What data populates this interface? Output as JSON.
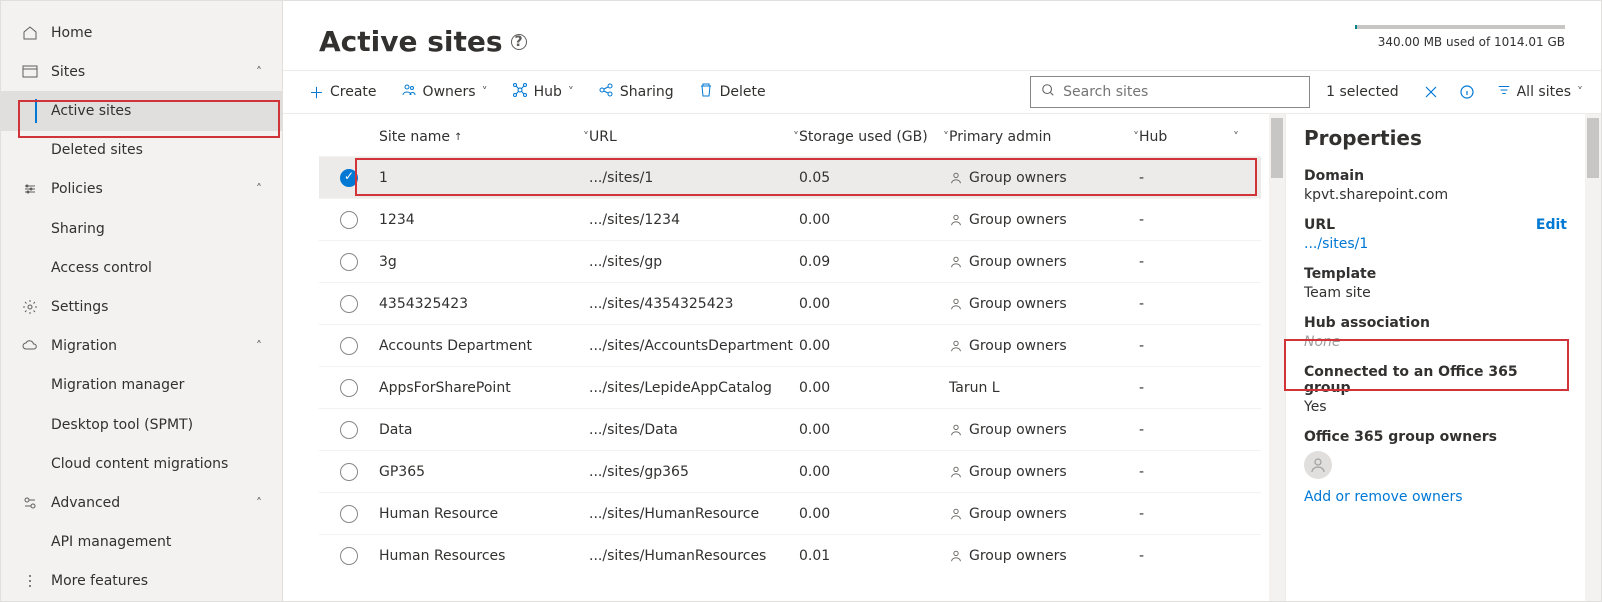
{
  "nav": {
    "home": "Home",
    "sites": "Sites",
    "active_sites": "Active sites",
    "deleted_sites": "Deleted sites",
    "policies": "Policies",
    "sharing": "Sharing",
    "access_control": "Access control",
    "settings": "Settings",
    "migration": "Migration",
    "migration_manager": "Migration manager",
    "desktop_tool": "Desktop tool (SPMT)",
    "cloud_content": "Cloud content migrations",
    "advanced": "Advanced",
    "api_management": "API management",
    "more_features": "More features"
  },
  "header": {
    "title": "Active sites",
    "storage_text": "340.00 MB used of 1014.01 GB",
    "storage_pct": 1
  },
  "cmd": {
    "create": "Create",
    "owners": "Owners",
    "hub": "Hub",
    "sharing": "Sharing",
    "delete": "Delete",
    "search_ph": "Search sites",
    "selected": "1 selected",
    "all_sites": "All sites"
  },
  "columns": {
    "site_name": "Site name",
    "url": "URL",
    "storage": "Storage used (GB)",
    "admin": "Primary admin",
    "hub": "Hub"
  },
  "rows": [
    {
      "selected": true,
      "name": "1",
      "url": ".../sites/1",
      "storage": "0.05",
      "admin": "Group owners",
      "admin_icon": true,
      "hub": "-"
    },
    {
      "selected": false,
      "name": "1234",
      "url": ".../sites/1234",
      "storage": "0.00",
      "admin": "Group owners",
      "admin_icon": true,
      "hub": "-"
    },
    {
      "selected": false,
      "name": "3g",
      "url": ".../sites/gp",
      "storage": "0.09",
      "admin": "Group owners",
      "admin_icon": true,
      "hub": "-"
    },
    {
      "selected": false,
      "name": "4354325423",
      "url": ".../sites/4354325423",
      "storage": "0.00",
      "admin": "Group owners",
      "admin_icon": true,
      "hub": "-"
    },
    {
      "selected": false,
      "name": "Accounts Department",
      "url": ".../sites/AccountsDepartment",
      "storage": "0.00",
      "admin": "Group owners",
      "admin_icon": true,
      "hub": "-"
    },
    {
      "selected": false,
      "name": "AppsForSharePoint",
      "url": ".../sites/LepideAppCatalog",
      "storage": "0.00",
      "admin": "Tarun L",
      "admin_icon": false,
      "hub": "-"
    },
    {
      "selected": false,
      "name": "Data",
      "url": ".../sites/Data",
      "storage": "0.00",
      "admin": "Group owners",
      "admin_icon": true,
      "hub": "-"
    },
    {
      "selected": false,
      "name": "GP365",
      "url": ".../sites/gp365",
      "storage": "0.00",
      "admin": "Group owners",
      "admin_icon": true,
      "hub": "-"
    },
    {
      "selected": false,
      "name": "Human Resource",
      "url": ".../sites/HumanResource",
      "storage": "0.00",
      "admin": "Group owners",
      "admin_icon": true,
      "hub": "-"
    },
    {
      "selected": false,
      "name": "Human Resources",
      "url": ".../sites/HumanResources",
      "storage": "0.01",
      "admin": "Group owners",
      "admin_icon": true,
      "hub": "-"
    }
  ],
  "panel": {
    "title": "Properties",
    "domain_label": "Domain",
    "domain_val": "kpvt.sharepoint.com",
    "url_label": "URL",
    "url_edit": "Edit",
    "url_val": ".../sites/1",
    "template_label": "Template",
    "template_val": "Team site",
    "hub_label": "Hub association",
    "hub_val": "None",
    "o365_label": "Connected to an Office 365 group",
    "o365_val": "Yes",
    "owners_label": "Office 365 group owners",
    "owners_link": "Add or remove owners"
  }
}
